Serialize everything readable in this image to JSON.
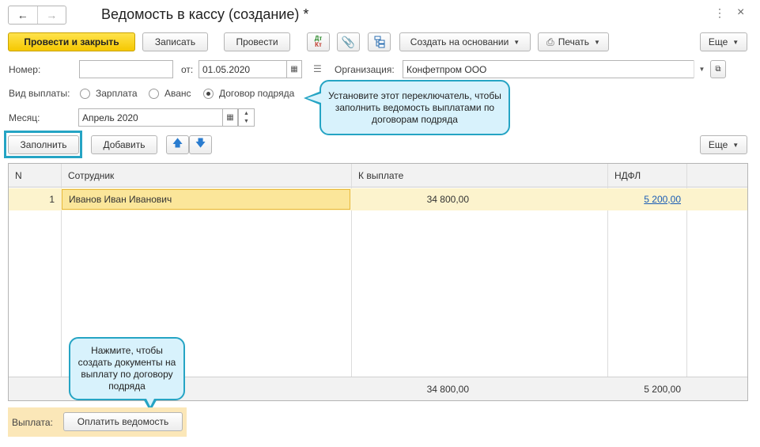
{
  "window": {
    "title": "Ведомость в кассу (создание) *",
    "nav_back_icon": "arrow-left-icon",
    "nav_forward_icon": "arrow-right-icon"
  },
  "toolbar": {
    "post_close_label": "Провести и закрыть",
    "save_label": "Записать",
    "post_label": "Провести",
    "dt_kt_label": "Дт Кт",
    "create_based_label": "Создать на основании",
    "print_label": "Печать",
    "more_label": "Еще"
  },
  "form": {
    "number_label": "Номер:",
    "number_value": "",
    "date_label": "от:",
    "date_value": "01.05.2020",
    "org_label": "Организация:",
    "org_value": "Конфетпром ООО",
    "payment_type_label": "Вид выплаты:",
    "payment_options": [
      "Зарплата",
      "Аванс",
      "Договор подряда"
    ],
    "payment_selected": "Договор подряда",
    "month_label": "Месяц:",
    "month_value": "Апрель 2020"
  },
  "table_toolbar": {
    "fill_label": "Заполнить",
    "add_label": "Добавить",
    "more_label": "Еще"
  },
  "table": {
    "columns": [
      "N",
      "Сотрудник",
      "К выплате",
      "НДФЛ"
    ],
    "rows": [
      {
        "n": "1",
        "employee": "Иванов Иван Иванович",
        "payout": "34 800,00",
        "ndfl": "5 200,00"
      }
    ],
    "footer": {
      "payout_total": "34 800,00",
      "ndfl_total": "5 200,00"
    }
  },
  "payment_bar": {
    "label": "Выплата:",
    "pay_button_label": "Оплатить ведомость"
  },
  "callouts": {
    "top": "Установите этот переключатель, чтобы заполнить ведомость выплатами по договорам подряда",
    "bottom": "Нажмите, чтобы создать документы на выплату по договору подряда"
  },
  "colors": {
    "accent_yellow": "#f5c800",
    "callout_border": "#25a4c4",
    "callout_fill": "#d8f2fc",
    "selected_row": "#fcf3cd",
    "link_blue": "#1a5cb5"
  }
}
